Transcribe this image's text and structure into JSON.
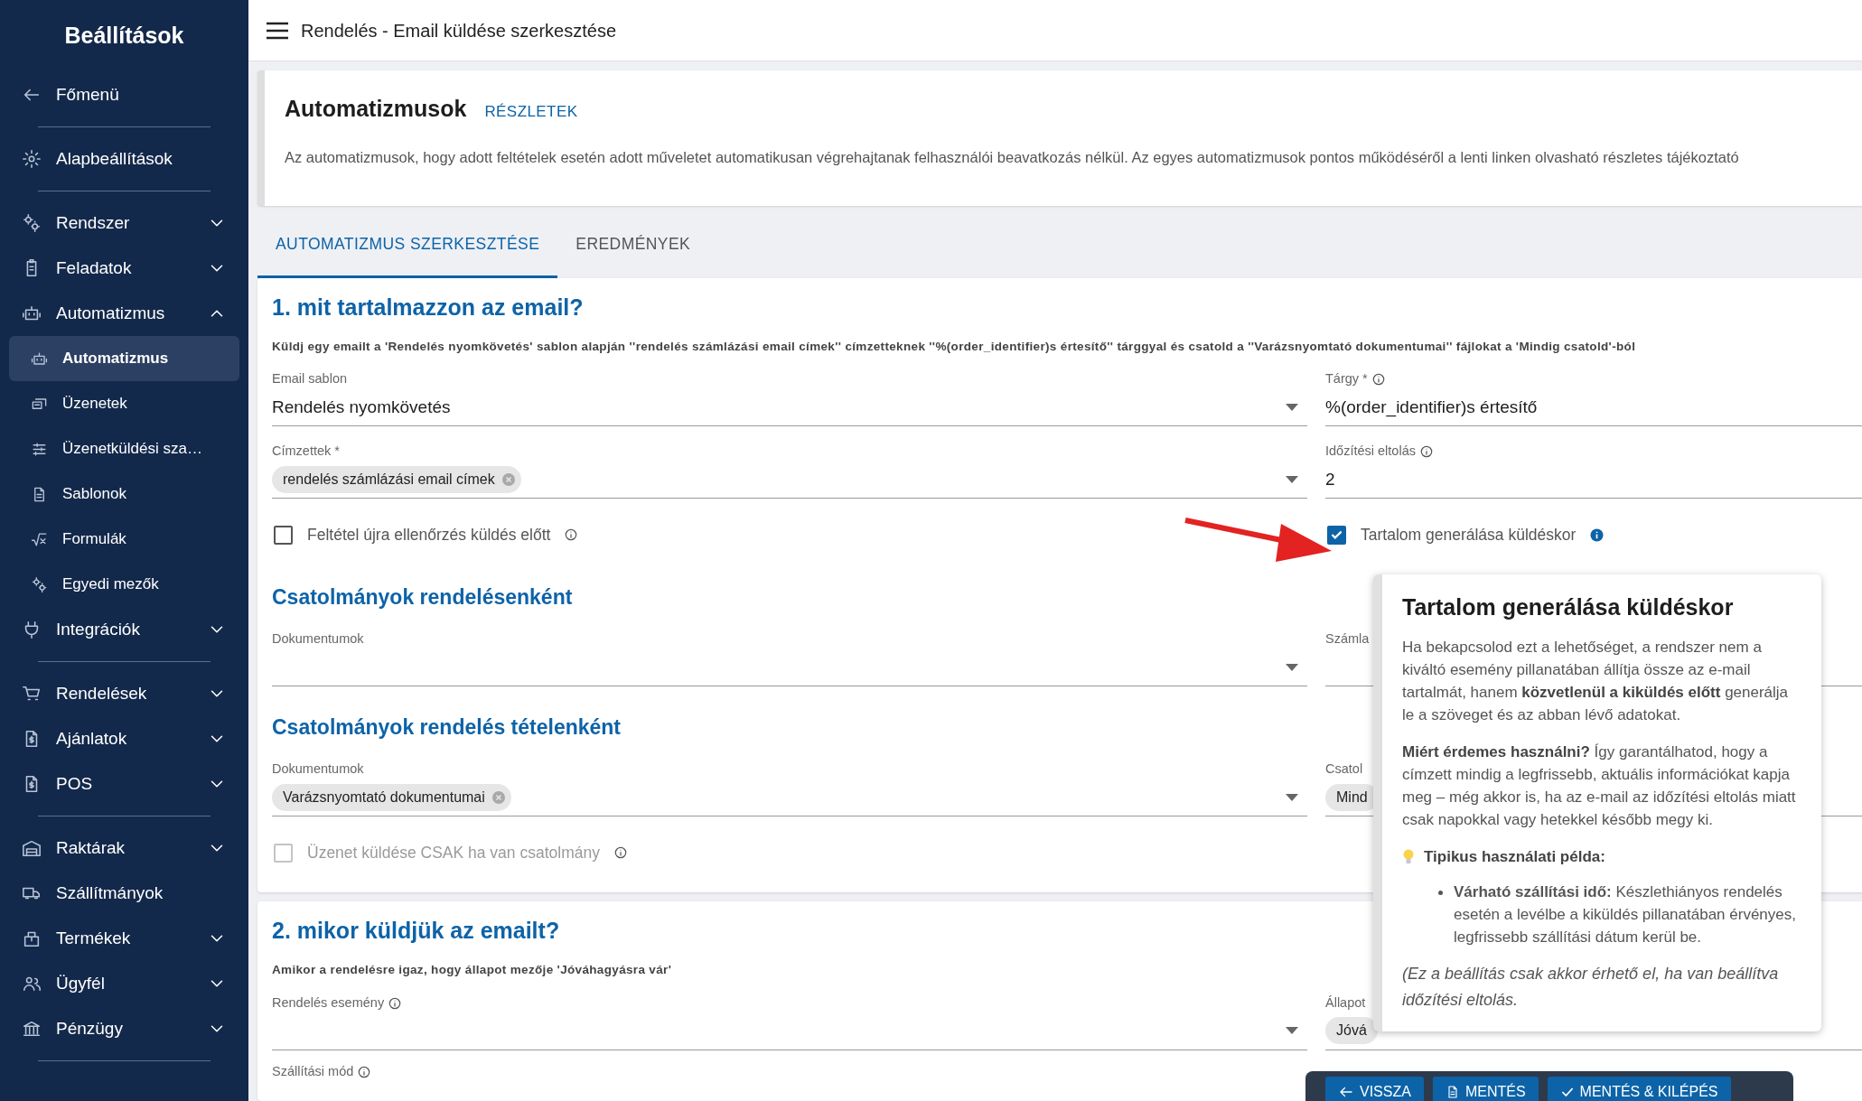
{
  "sidebar": {
    "title": "Beállítások",
    "groups": [
      {
        "items": [
          {
            "label": "Főmenü"
          }
        ]
      },
      {
        "items": [
          {
            "label": "Alapbeállítások"
          }
        ]
      },
      {
        "items": [
          {
            "label": "Rendszer",
            "expanded": false
          },
          {
            "label": "Feladatok",
            "expanded": false
          },
          {
            "label": "Automatizmus",
            "expanded": true,
            "children": [
              {
                "label": "Automatizmus",
                "selected": true
              },
              {
                "label": "Üzenetek",
                "selected": false
              },
              {
                "label": "Üzenetküldési sza…",
                "selected": false
              },
              {
                "label": "Sablonok",
                "selected": false
              },
              {
                "label": "Formulák",
                "selected": false
              },
              {
                "label": "Egyedi mezők",
                "selected": false
              }
            ]
          },
          {
            "label": "Integrációk",
            "expanded": false
          }
        ]
      },
      {
        "items": [
          {
            "label": "Rendelések",
            "expanded": false
          },
          {
            "label": "Ajánlatok",
            "expanded": false
          },
          {
            "label": "POS",
            "expanded": false
          }
        ]
      },
      {
        "items": [
          {
            "label": "Raktárak",
            "expanded": false
          },
          {
            "label": "Szállítmányok"
          },
          {
            "label": "Termékek",
            "expanded": false
          },
          {
            "label": "Ügyfél",
            "expanded": false
          },
          {
            "label": "Pénzügy",
            "expanded": false
          }
        ]
      }
    ]
  },
  "header": {
    "title": "Rendelés - Email küldése szerkesztése"
  },
  "info_card": {
    "title": "Automatizmusok",
    "link": "RÉSZLETEK",
    "description": "Az automatizmusok, hogy adott feltételek esetén adott műveletet automatikusan végrehajtanak felhasználói beavatkozás nélkül. Az egyes automatizmusok pontos működéséről a lenti linken olvasható részletes tájékoztató"
  },
  "tabs": [
    {
      "label": "AUTOMATIZMUS SZERKESZTÉSE",
      "selected": true
    },
    {
      "label": "EREDMÉNYEK",
      "selected": false
    }
  ],
  "sections": [
    {
      "heading": "1. mit tartalmazzon az email?",
      "summary": "Küldj egy emailt a 'Rendelés nyomkövetés' sablon alapján ''rendelés számlázási email címek'' címzetteknek ''%(order_identifier)s értesítő'' tárggyal és csatold a ''Varázsnyomtató dokumentumai'' fájlokat a 'Mindig csatold'-ból",
      "rows": [
        {
          "left": {
            "kind": "select",
            "label": "Email sablon",
            "value": "Rendelés nyomkövetés"
          },
          "right": {
            "kind": "text",
            "label": "Tárgy *",
            "info": true,
            "value": "%(order_identifier)s értesítő"
          }
        },
        {
          "left": {
            "kind": "chips",
            "label": "Címzettek *",
            "chips": [
              "rendelés számlázási email címek"
            ],
            "removable": true
          },
          "right": {
            "kind": "text",
            "label": "Időzítési eltolás",
            "info": true,
            "value": "2"
          }
        },
        {
          "left": {
            "kind": "checkbox",
            "label": "Feltétel újra ellenőrzés küldés előtt",
            "info": true,
            "checked": false,
            "disabled": false
          },
          "right": {
            "kind": "checkbox",
            "label": "Tartalom generálása küldéskor",
            "info": true,
            "info_highlighted": true,
            "checked": true,
            "disabled": false
          }
        },
        {
          "left": {
            "kind": "subheading",
            "label": "Csatolmányok rendelésenként"
          }
        },
        {
          "left": {
            "kind": "select",
            "label": "Dokumentumok"
          },
          "right": {
            "kind": "text",
            "label": "Számla"
          }
        },
        {
          "left": {
            "kind": "subheading",
            "label": "Csatolmányok rendelés tételenként"
          }
        },
        {
          "left": {
            "kind": "chips",
            "label": "Dokumentumok",
            "chips": [
              "Varázsnyomtató dokumentumai"
            ],
            "removable": true
          },
          "right": {
            "kind": "chips",
            "label": "Csatol",
            "chips": [
              "Mind"
            ],
            "removable": false
          }
        },
        {
          "left": {
            "kind": "checkbox",
            "label": "Üzenet küldése CSAK ha van csatolmány",
            "info": true,
            "checked": false,
            "disabled": true
          }
        }
      ]
    },
    {
      "heading": "2. mikor küldjük az emailt?",
      "summary": "Amikor a rendelésre igaz, hogy állapot mezője 'Jóváhagyásra vár'",
      "rows": [
        {
          "left": {
            "kind": "select",
            "label": "Rendelés esemény",
            "info": true
          },
          "right": {
            "kind": "chips",
            "label": "Állapot",
            "chips": [
              "Jóvá"
            ],
            "removable": false
          }
        },
        {
          "left": {
            "kind": "label",
            "label": "Szállítási mód",
            "info": true
          }
        }
      ]
    }
  ],
  "buttons": [
    {
      "label": "VISSZA",
      "kind": "back"
    },
    {
      "label": "MENTÉS",
      "kind": "save"
    },
    {
      "label": "MENTÉS & KILÉPÉS",
      "kind": "save_exit"
    }
  ],
  "tooltip": {
    "title": "Tartalom generálása küldéskor",
    "paragraphs": [
      "Ha bekapcsolod ezt a lehetőséget, a rendszer nem a kiváltó esemény pillanatában állítja össze az e-mail tartalmát, hanem **közvetlenül a kiküldés előtt** generálja le a szöveget és az abban lévő adatokat.",
      "**Miért érdemes használni?** Így garantálhatod, hogy a címzett mindig a legfrissebb, aktuális információkat kapja meg – még akkor is, ha az e-mail az időzítési eltolás miatt csak napokkal vagy hetekkel később megy ki."
    ],
    "example_heading": "Tipikus használati példa:",
    "examples": [
      "**Várható szállítási idő:** Készlethiányos rendelés esetén a levélbe a kiküldés pillanatában érvényes, legfrissebb szállítási dátum kerül be."
    ],
    "note": "(Ez a beállítás csak akkor érhető el, ha van beállítva időzítési eltolás."
  }
}
